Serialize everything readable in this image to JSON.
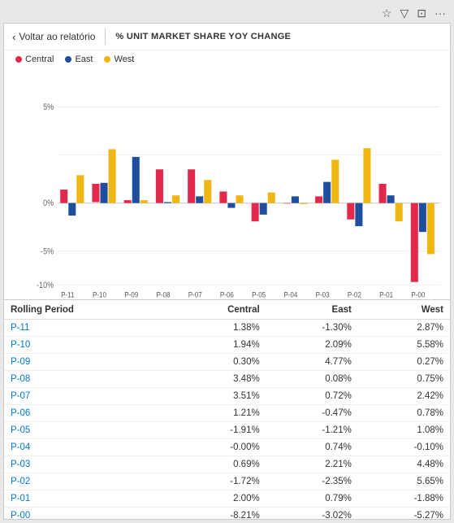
{
  "topbar": {
    "icons": [
      "pin-icon",
      "filter-icon",
      "focus-icon",
      "more-icon"
    ]
  },
  "header": {
    "back_label": "Voltar ao relatório",
    "title": "% UNIT MARKET SHARE YOY CHANGE"
  },
  "legend": [
    {
      "label": "Central",
      "color": "#E3294B"
    },
    {
      "label": "East",
      "color": "#1F4E9E"
    },
    {
      "label": "West",
      "color": "#F0B614"
    }
  ],
  "chart": {
    "y_labels": [
      "5%",
      "0%",
      "-5%",
      "-10%"
    ],
    "x_labels": [
      "P-11",
      "P-10",
      "P-09",
      "P-08",
      "P-07",
      "P-06",
      "P-05",
      "P-04",
      "P-03",
      "P-02",
      "P-01",
      "P-00"
    ],
    "bars": [
      {
        "period": "P-11",
        "central": 1.38,
        "east": -1.3,
        "west": 2.87
      },
      {
        "period": "P-10",
        "central": 1.94,
        "east": 2.09,
        "west": 5.58
      },
      {
        "period": "P-09",
        "central": 0.3,
        "east": 4.77,
        "west": 0.27
      },
      {
        "period": "P-08",
        "central": 3.48,
        "east": 0.08,
        "west": 0.75
      },
      {
        "period": "P-07",
        "central": 3.51,
        "east": 0.72,
        "west": 2.42
      },
      {
        "period": "P-06",
        "central": 1.21,
        "east": -0.47,
        "west": 0.78
      },
      {
        "period": "P-05",
        "central": -1.91,
        "east": -1.21,
        "west": 1.08
      },
      {
        "period": "P-04",
        "central": -0.0,
        "east": 0.74,
        "west": -0.1
      },
      {
        "period": "P-03",
        "central": 0.69,
        "east": 2.21,
        "west": 4.48
      },
      {
        "period": "P-02",
        "central": -1.72,
        "east": -2.35,
        "west": 5.65
      },
      {
        "period": "P-01",
        "central": 2.0,
        "east": 0.79,
        "west": -1.88
      },
      {
        "period": "P-00",
        "central": -8.21,
        "east": -3.02,
        "west": -5.27
      }
    ]
  },
  "table": {
    "columns": [
      "Rolling Period",
      "Central",
      "East",
      "West"
    ],
    "rows": [
      {
        "period": "P-11",
        "central": "1.38%",
        "east": "-1.30%",
        "west": "2.87%"
      },
      {
        "period": "P-10",
        "central": "1.94%",
        "east": "2.09%",
        "west": "5.58%"
      },
      {
        "period": "P-09",
        "central": "0.30%",
        "east": "4.77%",
        "west": "0.27%"
      },
      {
        "period": "P-08",
        "central": "3.48%",
        "east": "0.08%",
        "west": "0.75%"
      },
      {
        "period": "P-07",
        "central": "3.51%",
        "east": "0.72%",
        "west": "2.42%"
      },
      {
        "period": "P-06",
        "central": "1.21%",
        "east": "-0.47%",
        "west": "0.78%"
      },
      {
        "period": "P-05",
        "central": "-1.91%",
        "east": "-1.21%",
        "west": "1.08%"
      },
      {
        "period": "P-04",
        "central": "-0.00%",
        "east": "0.74%",
        "west": "-0.10%"
      },
      {
        "period": "P-03",
        "central": "0.69%",
        "east": "2.21%",
        "west": "4.48%"
      },
      {
        "period": "P-02",
        "central": "-1.72%",
        "east": "-2.35%",
        "west": "5.65%"
      },
      {
        "period": "P-01",
        "central": "2.00%",
        "east": "0.79%",
        "west": "-1.88%"
      },
      {
        "period": "P-00",
        "central": "-8.21%",
        "east": "-3.02%",
        "west": "-5.27%"
      }
    ]
  }
}
